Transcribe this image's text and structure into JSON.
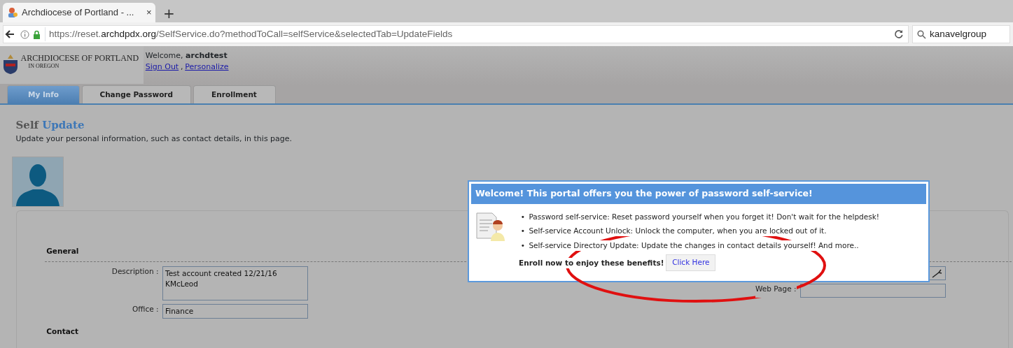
{
  "browser": {
    "tab": {
      "title": "Archdiocese of Portland - ...",
      "close": "×"
    },
    "new_tab": "+",
    "url": {
      "prefix": "https://reset.",
      "domain": "archdpdx.org",
      "path": "/SelfService.do?methodToCall=selfService&selectedTab=UpdateFields"
    },
    "search": {
      "value": "kanavelgroup"
    }
  },
  "header": {
    "logo": {
      "title": "ARCHDIOCESE OF PORTLAND",
      "subtitle": "IN OREGON"
    },
    "welcome": "Welcome, **archdtest**",
    "links": [
      {
        "label": "Sign Out"
      },
      {
        "label": "Personalize"
      }
    ],
    "separator": ","
  },
  "tabs": [
    {
      "label": "My Info",
      "selected": true
    },
    {
      "label": "Change Password",
      "selected": false
    },
    {
      "label": "Enrollment",
      "selected": false
    }
  ],
  "page": {
    "title": [
      "Self",
      "Update"
    ],
    "subtitle": "Update your personal information, such as contact details, in this page.",
    "sections": [
      {
        "heading": "General"
      },
      {
        "heading": "Contact"
      }
    ],
    "left_fields": [
      {
        "label": "Description :",
        "value": "Test account created 12/21/16\nKMcLeod",
        "kind": "textarea"
      },
      {
        "label": "Office :",
        "value": "Finance",
        "kind": "text"
      }
    ],
    "right_fields": [
      {
        "kind": "picker"
      },
      {
        "label": "Web Page :",
        "kind": "text"
      }
    ]
  },
  "modal": {
    "title": "Welcome! This portal offers you the power of password self-service!",
    "marker": "•",
    "bullets": [
      "Password self-service: Reset password yourself when you forget it! Don't wait for the helpdesk!",
      "Self-service Account Unlock: Unlock the computer, when you are locked out of it.",
      "Self-service Directory Update: Update the changes in contact details yourself! And more.."
    ],
    "enroll_text": "Enroll now to enjoy these benefits!",
    "button": "Click Here"
  }
}
